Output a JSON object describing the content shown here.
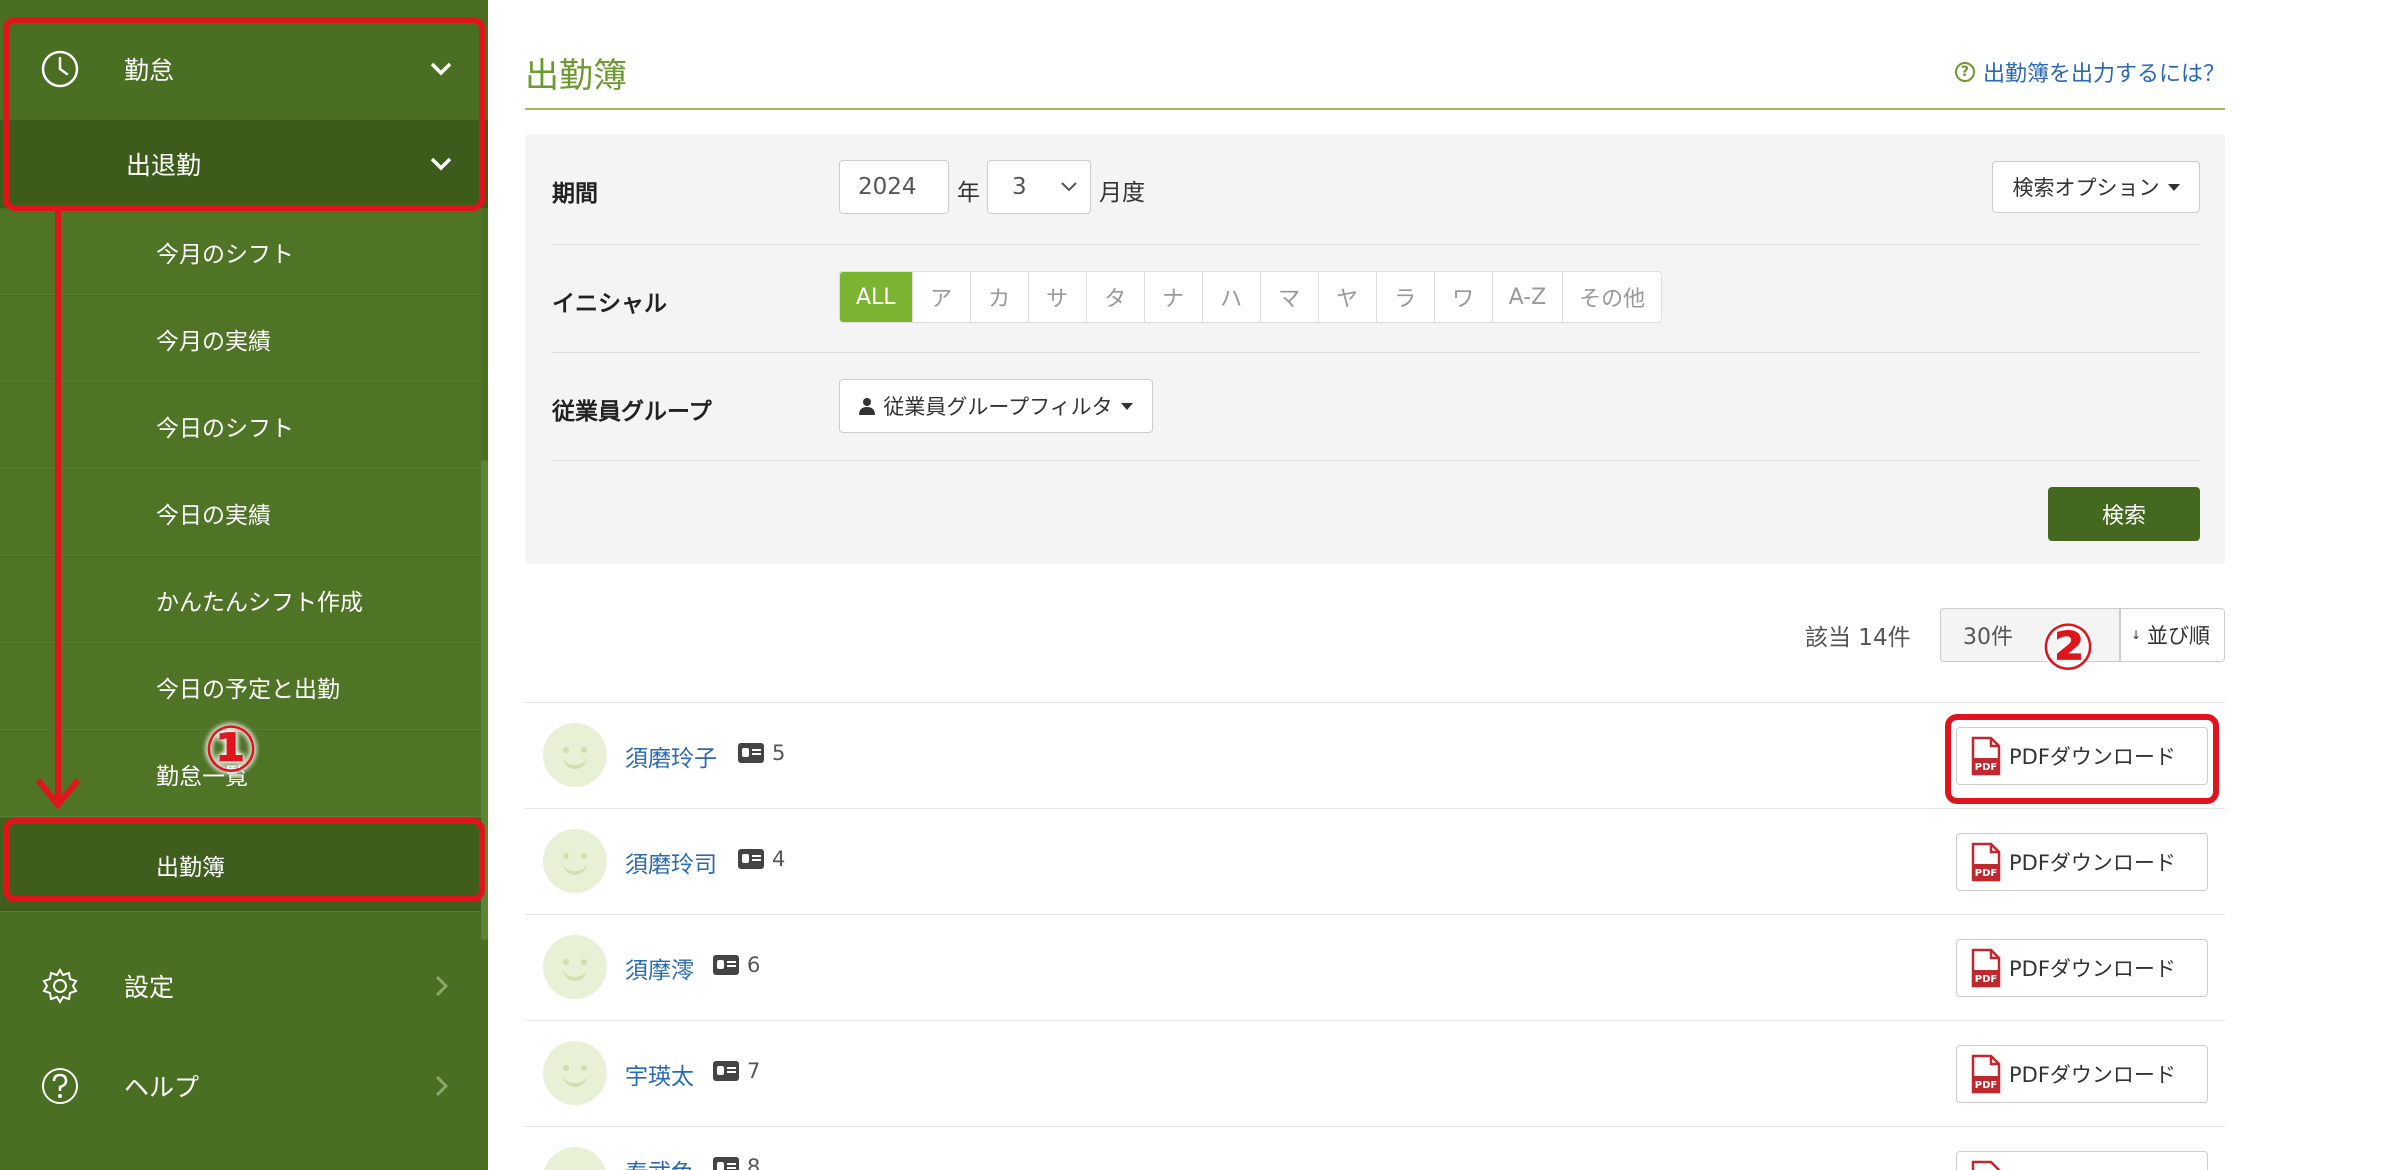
{
  "sidebar": {
    "kintai_label": "勤怠",
    "shuttai_label": "出退勤",
    "items": [
      {
        "label": "今月のシフト"
      },
      {
        "label": "今月の実績"
      },
      {
        "label": "今日のシフト"
      },
      {
        "label": "今日の実績"
      },
      {
        "label": "かんたんシフト作成"
      },
      {
        "label": "今日の予定と出勤"
      },
      {
        "label": "勤怠一覧"
      },
      {
        "label": "出勤簿"
      }
    ],
    "settei_label": "設定",
    "help_label": "ヘルプ"
  },
  "annotations": {
    "marker1": "①",
    "marker2": "②",
    "color": "#e0141c"
  },
  "header": {
    "title": "出勤簿",
    "help_link": "出勤簿を出力するには？"
  },
  "filter": {
    "period_label": "期間",
    "year_value": "2024",
    "year_suffix": "年",
    "month_value": "3",
    "month_suffix": "月度",
    "search_options": "検索オプション",
    "initial_label": "イニシャル",
    "initials": [
      "ALL",
      "ア",
      "カ",
      "サ",
      "タ",
      "ナ",
      "ハ",
      "マ",
      "ヤ",
      "ラ",
      "ワ",
      "A-Z",
      "その他"
    ],
    "group_label": "従業員グループ",
    "group_filter": "従業員グループフィルタ",
    "search_button": "検索"
  },
  "results": {
    "count_text": "該当 14件",
    "per_page": "30件",
    "sort_label": "並び順",
    "pdf_label": "PDFダウンロード",
    "employees": [
      {
        "name": "須磨玲子",
        "badge_count": "5"
      },
      {
        "name": "須磨玲司",
        "badge_count": "4"
      },
      {
        "name": "須摩澪",
        "badge_count": "6"
      },
      {
        "name": "宇瑛太",
        "badge_count": "7"
      },
      {
        "name": "泰武色",
        "badge_count": "8"
      }
    ]
  },
  "colors": {
    "sidebar_bg": "#4a6e22",
    "accent_green": "#7cb431",
    "search_button": "#446820",
    "link_blue": "#2a6ab5"
  }
}
